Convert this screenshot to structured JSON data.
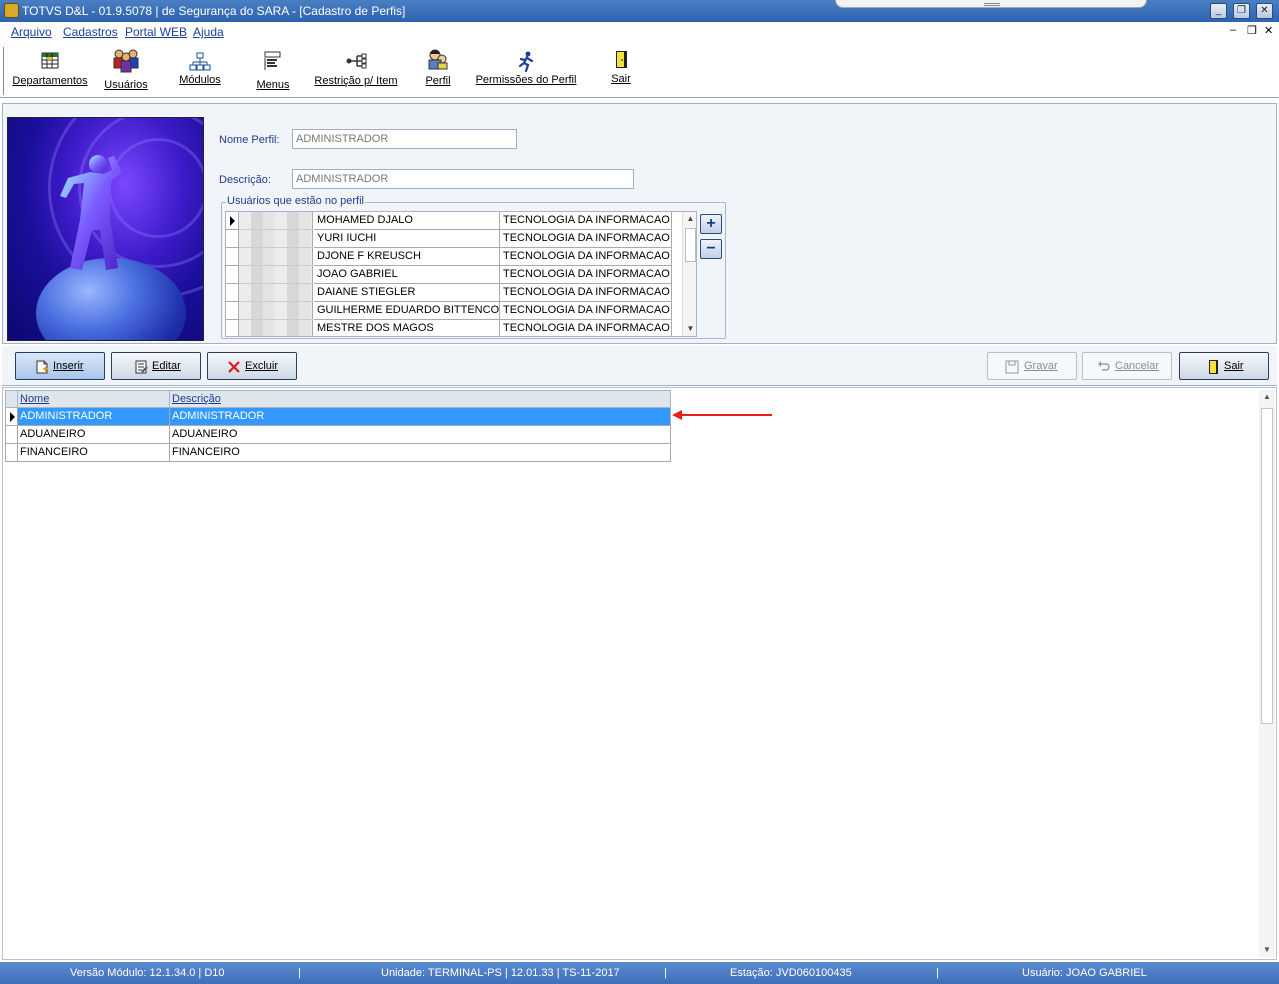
{
  "window": {
    "title": "TOTVS D&L - 01.9.5078 | de Segurança do SARA - [Cadastro de Perfis]"
  },
  "menu": {
    "items": [
      "Arquivo",
      "Cadastros",
      "Portal WEB",
      "Ajuda"
    ]
  },
  "toolbar": {
    "items": [
      {
        "label": "Departamentos",
        "icon": "grid-table-icon"
      },
      {
        "label": "Usuários",
        "icon": "users-group-icon"
      },
      {
        "label": "Módulos",
        "icon": "hierarchy-icon"
      },
      {
        "label": "Menus",
        "icon": "menu-list-icon"
      },
      {
        "label": "Restrição p/ Item",
        "icon": "restriction-tree-icon"
      },
      {
        "label": "Perfil",
        "icon": "profile-people-icon"
      },
      {
        "label": "Permissões do Perfil",
        "icon": "running-person-icon"
      },
      {
        "label": "Sair",
        "icon": "exit-door-icon"
      }
    ]
  },
  "form": {
    "nome_label": "Nome Perfil:",
    "nome_value": "ADMINISTRADOR",
    "descricao_label": "Descrição:",
    "descricao_value": "ADMINISTRADOR",
    "users_group_title": "Usuários que estão no perfil",
    "users": [
      {
        "name": "MOHAMED DJALO",
        "department": "TECNOLOGIA DA INFORMACAO"
      },
      {
        "name": "YURI IUCHI",
        "department": "TECNOLOGIA DA INFORMACAO"
      },
      {
        "name": "DJONE F KREUSCH",
        "department": "TECNOLOGIA DA INFORMACAO"
      },
      {
        "name": "JOAO GABRIEL",
        "department": "TECNOLOGIA DA INFORMACAO"
      },
      {
        "name": "DAIANE STIEGLER",
        "department": "TECNOLOGIA DA INFORMACAO"
      },
      {
        "name": "GUILHERME EDUARDO BITTENCOURT",
        "department": "TECNOLOGIA DA INFORMACAO"
      },
      {
        "name": "MESTRE DOS MAGOS",
        "department": "TECNOLOGIA DA INFORMACAO"
      }
    ],
    "add_label": "+",
    "remove_label": "−"
  },
  "actions": {
    "inserir": "Inserir",
    "editar": "Editar",
    "excluir": "Excluir",
    "gravar": "Gravar",
    "cancelar": "Cancelar",
    "sair": "Sair"
  },
  "grid": {
    "columns": [
      "Nome",
      "Descrição"
    ],
    "rows": [
      {
        "nome": "ADMINISTRADOR",
        "descricao": "ADMINISTRADOR",
        "selected": true
      },
      {
        "nome": "ADUANEIRO",
        "descricao": "ADUANEIRO",
        "selected": false
      },
      {
        "nome": "FINANCEIRO",
        "descricao": "FINANCEIRO",
        "selected": false
      }
    ]
  },
  "status": {
    "versao": "Versão Módulo:  12.1.34.0  |  D10",
    "unidade": "Unidade: TERMINAL-PS | 12.01.33 | TS-11-2017",
    "estacao": "Estação: JVD060100435",
    "usuario": "Usuário: JOAO GABRIEL"
  },
  "colors": {
    "selection": "#3399ff",
    "annotation_arrow": "#e8201a",
    "title_bar": "#2d63ad"
  }
}
